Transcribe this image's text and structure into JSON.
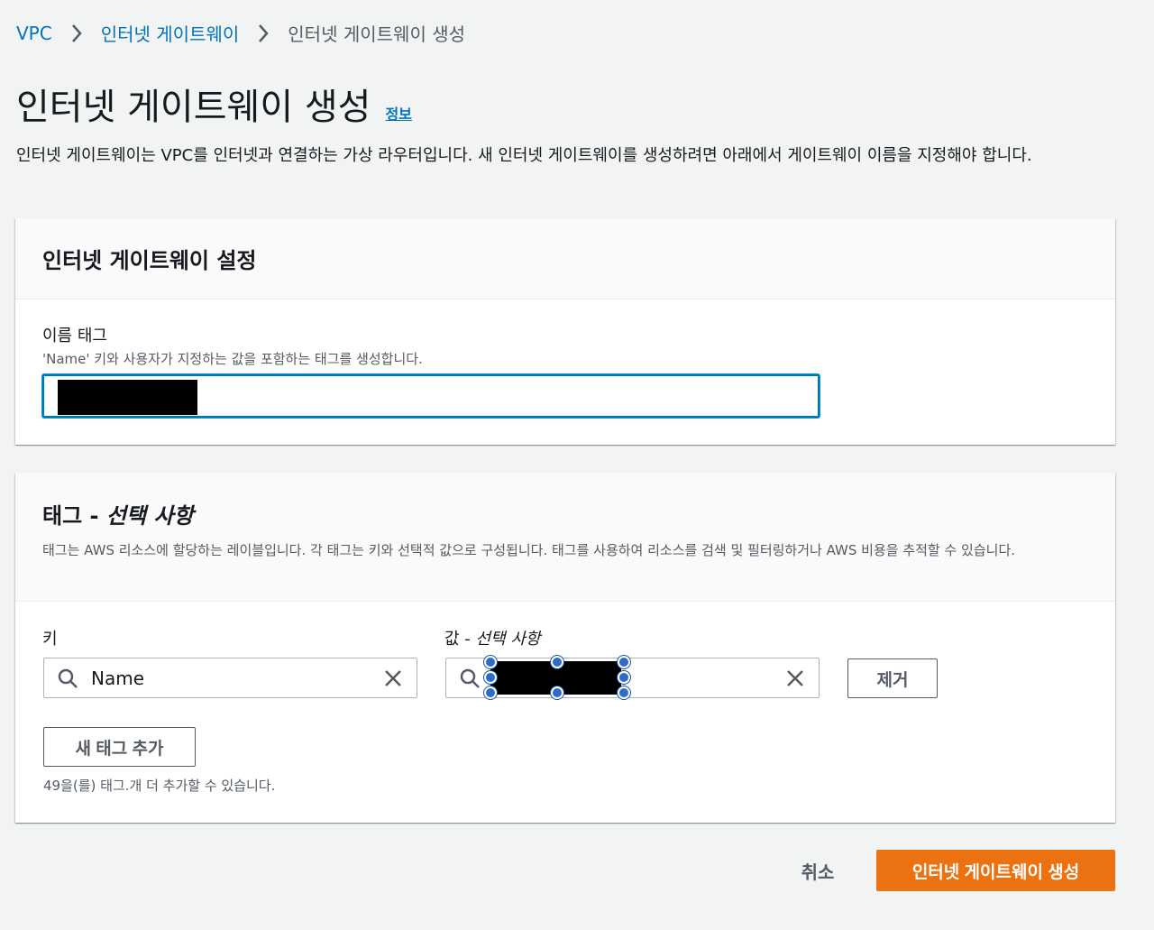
{
  "breadcrumb": {
    "items": [
      "VPC",
      "인터넷 게이트웨이"
    ],
    "current": "인터넷 게이트웨이 생성"
  },
  "header": {
    "title": "인터넷 게이트웨이 생성",
    "info_link": "정보",
    "description": "인터넷 게이트웨이는 VPC를 인터넷과 연결하는 가상 라우터입니다. 새 인터넷 게이트웨이를 생성하려면 아래에서 게이트웨이 이름을 지정해야 합니다."
  },
  "settings_panel": {
    "title": "인터넷 게이트웨이 설정",
    "name_tag_label": "이름 태그",
    "name_tag_desc": "'Name' 키와 사용자가 지정하는 값을 포함하는 태그를 생성합니다."
  },
  "tags_panel": {
    "title_main": "태그 - ",
    "title_optional": "선택 사항",
    "description": "태그는 AWS 리소스에 할당하는 레이블입니다. 각 태그는 키와 선택적 값으로 구성됩니다. 태그를 사용하여 리소스를 검색 및 필터링하거나 AWS 비용을 추적할 수 있습니다.",
    "key_label": "키",
    "value_label_main": "값 - ",
    "value_label_optional": "선택 사항",
    "key_value": "Name",
    "remove_button": "제거",
    "add_tag_button": "새 태그 추가",
    "remaining_hint": "49을(를) 태그.개 더 추가할 수 있습니다."
  },
  "footer": {
    "cancel": "취소",
    "submit": "인터넷 게이트웨이 생성"
  },
  "colors": {
    "link": "#0073bb",
    "primary": "#ec7211",
    "background": "#f2f3f3"
  }
}
